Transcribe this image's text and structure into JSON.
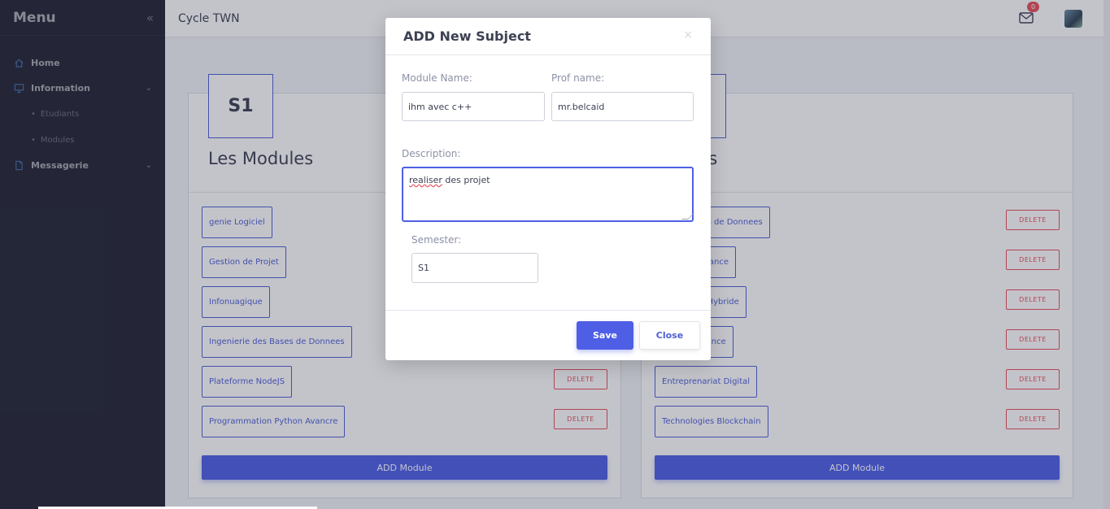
{
  "sidebar": {
    "title": "Menu",
    "items": [
      {
        "label": "Home",
        "icon": "home-icon"
      },
      {
        "label": "Information",
        "icon": "monitor-icon"
      },
      {
        "label": "Messagerie",
        "icon": "document-icon"
      }
    ],
    "sub_items": [
      {
        "label": "Etudiants"
      },
      {
        "label": "Modules"
      }
    ]
  },
  "header": {
    "title": "Cycle TWN",
    "mail_count": "0"
  },
  "cards": [
    {
      "semester": "S1",
      "title": "Les Modules",
      "modules": [
        "genie Logiciel",
        "Gestion de Projet",
        "Infonuagique",
        "Ingenierie des Bases de Donnees",
        "Plateforme NodeJS",
        "Programmation Python Avancre"
      ],
      "delete_label": "DELETE",
      "add_label": "ADD Module"
    },
    {
      "title": "odules",
      "modules": [
        "on de Bases de Donnees",
        "on Linux Avance",
        "ent Mobile Hybride",
        "ent PHP Avance",
        "Entreprenariat Digital",
        "Technologies Blockchain"
      ],
      "delete_label": "DELETE",
      "add_label": "ADD Module"
    }
  ],
  "modal": {
    "title": "ADD New Subject",
    "close_glyph": "×",
    "module_name_label": "Module Name:",
    "module_name_value": "ihm avec c++",
    "prof_name_label": "Prof name:",
    "prof_name_value": "mr.belcaid",
    "description_label": "Description:",
    "description_misspelled": "realiser",
    "description_rest": " des projet",
    "semester_label": "Semester:",
    "semester_value": "S1",
    "save_label": "Save",
    "close_label": "Close"
  },
  "colors": {
    "accent": "#4e5fe6",
    "danger": "#e8505b",
    "sidebar": "#2b2f41"
  }
}
